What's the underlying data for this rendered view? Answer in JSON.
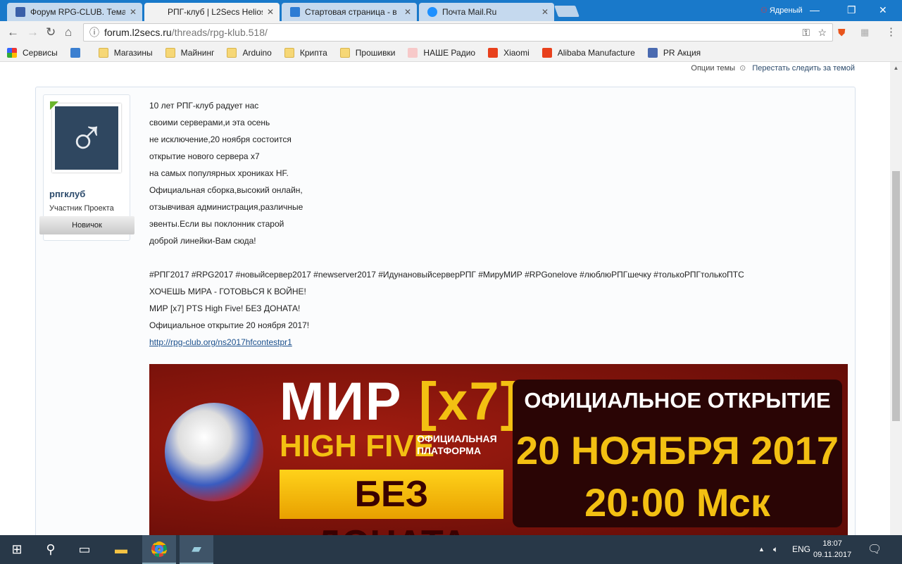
{
  "browser": {
    "tabs": [
      {
        "label": "Форум RPG-CLUB. Тема",
        "active": false,
        "color": "#3a5fa8"
      },
      {
        "label": "РПГ-клуб | L2Secs Helios",
        "active": true,
        "color": "#111111"
      },
      {
        "label": "Стартовая страница - в",
        "active": false,
        "color": "#2d7cd4"
      },
      {
        "label": "Почта Mail.Ru",
        "active": false,
        "color": "#1e90ff"
      }
    ],
    "profile": "Ядреный",
    "url_host": "forum.l2secs.ru",
    "url_path": "/threads/rpg-klub.518/",
    "bookmarks": [
      "Сервисы",
      "Магазины",
      "Майнинг",
      "Arduino",
      "Крипта",
      "Прошивки",
      "НАШЕ Радио",
      "Xiaomi",
      "Alibaba Manufacture",
      "PR Акция"
    ]
  },
  "thread": {
    "options": "Опции темы",
    "unwatch": "Перестать следить за темой"
  },
  "post": {
    "username": "рпгклуб",
    "user_title": "Участник Проекта",
    "rank": "Новичок",
    "lines": [
      "10 лет РПГ-клуб радует нас",
      "своими серверами,и эта осень",
      "не исключение,20 ноября состоится",
      "открытие нового сервера x7",
      "на самых популярных хрониках HF.",
      "Официальная сборка,высокий онлайн,",
      "отзывчивая администрация,различные",
      "эвенты.Если вы поклонник старой",
      "доброй линейки-Вам сюда!"
    ],
    "hashtags": "#РПГ2017 #RPG2017 #новыйсервер2017 #newserver2017 #ИдунановыйсерверРПГ #МируМИР #RPGonelove #люблюРПГшечку #толькоРПГтолькоПТС",
    "l1": "ХОЧЕШЬ МИРА - ГОТОВЬСЯ К ВОЙНЕ!",
    "l2": "МИР [x7] PTS High Five! БЕЗ ДОНАТА!",
    "l3": "Официальное открытие 20 ноября 2017!",
    "link": "http://rpg-club.org/ns2017hfcontestpr1"
  },
  "banner": {
    "mir": "МИР",
    "x7": "[x7]",
    "hf": "HIGH FIVE",
    "plat1": "ОФИЦИАЛЬНАЯ",
    "plat2": "ПЛАТФОРМА",
    "no_donate": "БЕЗ ДОНАТА",
    "open": "ОФИЦИАЛЬНОЕ ОТКРЫТИЕ",
    "date": "20 НОЯБРЯ 2017",
    "time": "20:00 Мск"
  },
  "taskbar": {
    "lang": "ENG",
    "time": "18:07",
    "date": "09.11.2017"
  }
}
